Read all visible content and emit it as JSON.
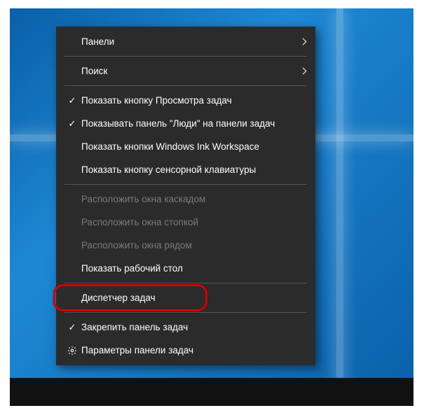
{
  "menu": {
    "groups": [
      [
        {
          "id": "panels",
          "label": "Панели",
          "submenu": true
        },
        {
          "id": "search",
          "label": "Поиск",
          "submenu": true
        }
      ],
      [
        {
          "id": "task-view-btn",
          "label": "Показать кнопку Просмотра задач",
          "checked": true
        },
        {
          "id": "people-bar",
          "label": "Показывать панель \"Люди\" на панели задач",
          "checked": true
        },
        {
          "id": "ink-workspace",
          "label": "Показать кнопки Windows Ink Workspace"
        },
        {
          "id": "touch-keyboard",
          "label": "Показать кнопку сенсорной клавиатуры"
        }
      ],
      [
        {
          "id": "cascade",
          "label": "Расположить окна каскадом",
          "disabled": true
        },
        {
          "id": "stack",
          "label": "Расположить окна стопкой",
          "disabled": true
        },
        {
          "id": "sidebyside",
          "label": "Расположить окна рядом",
          "disabled": true
        },
        {
          "id": "show-desktop",
          "label": "Показать рабочий стол"
        }
      ],
      [
        {
          "id": "task-manager",
          "label": "Диспетчер задач",
          "highlighted": true
        }
      ],
      [
        {
          "id": "lock-taskbar",
          "label": "Закрепить панель задач",
          "checked": true
        },
        {
          "id": "taskbar-settings",
          "label": "Параметры панели задач",
          "icon": "gear"
        }
      ]
    ]
  }
}
